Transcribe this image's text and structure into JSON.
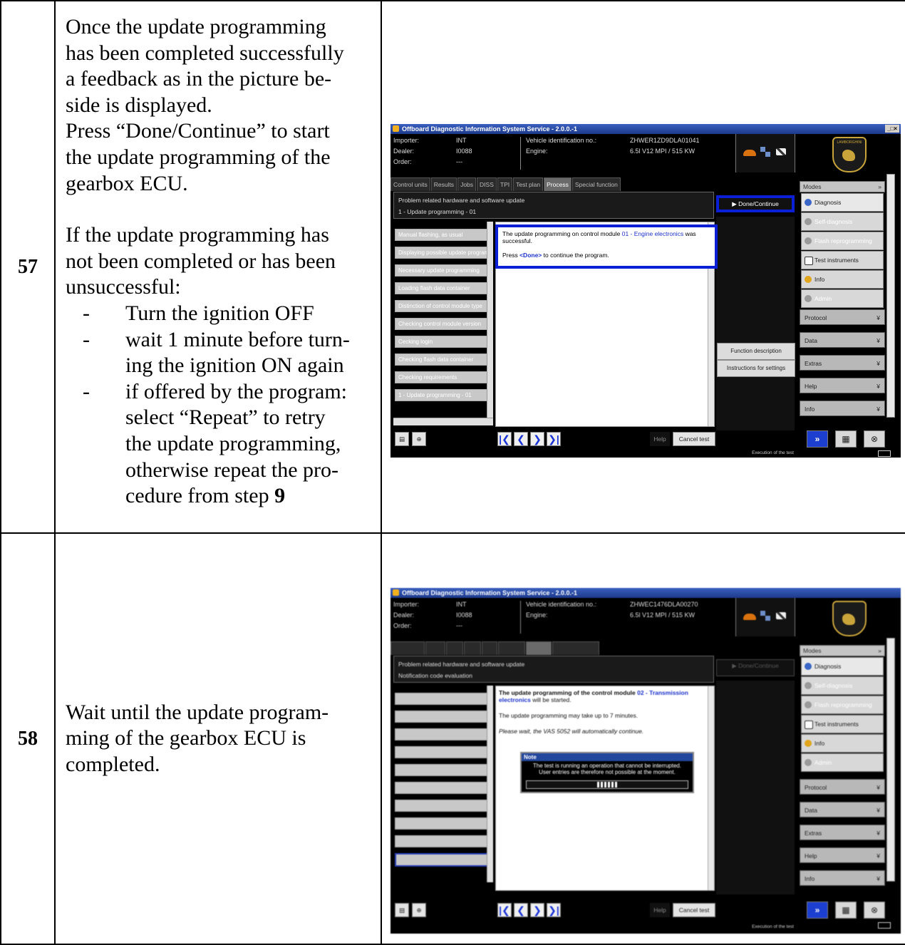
{
  "steps": [
    {
      "number": "57",
      "intro_lines": [
        "Once the update programming",
        "has been completed successfully",
        "a feedback as in the picture be-",
        "side is displayed.",
        "Press “Done/Continue” to start",
        "the update programming of the",
        "gearbox ECU."
      ],
      "failure_lines": [
        "If the update programming has",
        "not been completed or has been",
        "unsuccessful:"
      ],
      "bullets": [
        {
          "dash": "-",
          "lines": [
            "Turn the ignition OFF"
          ]
        },
        {
          "dash": "-",
          "lines": [
            "wait 1 minute before turn-",
            "ing the ignition ON again"
          ]
        },
        {
          "dash": "-",
          "lines": [
            "if offered by the program:",
            "select “Repeat” to retry",
            "the update programming,",
            "otherwise repeat the pro-",
            "cedure from step "
          ],
          "bold_suffix": "9"
        }
      ]
    },
    {
      "number": "58",
      "lines": [
        "Wait until the update program-",
        "ming of the gearbox ECU is",
        "completed."
      ]
    }
  ],
  "shot1": {
    "title": "Offboard Diagnostic Information System Service - 2.0.0.-1",
    "window_buttons": "_□×",
    "importer_label": "Importer:",
    "importer_value": "INT",
    "dealer_label": "Dealer:",
    "dealer_value": "I0088",
    "order_label": "Order:",
    "order_value": "---",
    "vin_label": "Vehicle identification no.:",
    "vin_value": "ZHWER1ZD9DLA01041",
    "engine_label": "Engine:",
    "engine_value": "6.5l V12 MPI / 515 KW",
    "logo_text": "LAMBORGHINI",
    "tabs": [
      "Control units",
      "Results",
      "Jobs",
      "DISS",
      "TPI",
      "Test plan",
      "Process",
      "Special function"
    ],
    "active_tab": "Process",
    "info_line1": "Problem related hardware and software update",
    "info_line2": "1 - Update programming - 01",
    "done_button": "▶ Done/Continue",
    "step_items": [
      "Manual flashing, as usual",
      "Displaying possible update programming",
      "Necessary update programming",
      "Loading flash data container",
      "Distinction of control module type",
      "Checking control module version",
      "Cecking login",
      "Checking flash data container",
      "Checking requirements",
      "1 - Update programming - 01"
    ],
    "feedback_text1": "The update programming on control module ",
    "feedback_module": "01 - Engine electronics",
    "feedback_text2": " was successful.",
    "feedback_press": "Press ",
    "feedback_done": "<Done>",
    "feedback_press2": " to continue the program.",
    "function_description": "Function description",
    "instructions_settings": "Instructions for settings",
    "modes_title": "Modes",
    "modes": [
      "Diagnosis",
      "Self-diagnosis",
      "Flash reprogramming",
      "Test instruments",
      "Info",
      "Admin"
    ],
    "menus": [
      "Protocol",
      "Data",
      "Extras",
      "Help",
      "Info"
    ],
    "help_button": "Help",
    "cancel_button": "Cancel test",
    "status_text": "Execution of the test",
    "colors": {
      "highlight": "#0b1fd6",
      "title_bar": "#24479e",
      "module_link": "#1c32c9",
      "car": "#d9720e",
      "logo_gold": "#c9a43a"
    }
  },
  "shot2": {
    "title": "Offboard Diagnostic Information System Service - 2.0.0.-1",
    "importer_label": "Importer:",
    "importer_value": "INT",
    "dealer_label": "Dealer:",
    "dealer_value": "I0088",
    "order_label": "Order:",
    "order_value": "---",
    "vin_label": "Vehicle identification no.:",
    "vin_value": "ZHWEC1476DLA00270",
    "engine_label": "Engine:",
    "engine_value": "6.5l V12 MPI / 515 KW",
    "info_line1": "Problem related hardware and software update",
    "info_line2": "Notification code evaluation",
    "done_button": "▶ Done/Continue",
    "msg1_a": "The update programming of the control module ",
    "msg1_module": "02 - Transmission electronics",
    "msg1_b": " will be started.",
    "msg2": "The update programming may take up to 7 minutes.",
    "msg3": "Please wait, the VAS 5052 will automatically continue.",
    "note_title": "Note",
    "note_line1": "The test is running an operation that cannot be interrupted.",
    "note_line2": "User entries are therefore not possible at the moment.",
    "progress": 0.12,
    "modes_title": "Modes",
    "modes": [
      "Diagnosis",
      "Self-diagnosis",
      "Flash reprogramming",
      "Test instruments",
      "Info",
      "Admin"
    ],
    "menus": [
      "Protocol",
      "Data",
      "Extras",
      "Help",
      "Info"
    ],
    "help_button": "Help",
    "cancel_button": "Cancel test",
    "status_text": "Execution of the test"
  }
}
